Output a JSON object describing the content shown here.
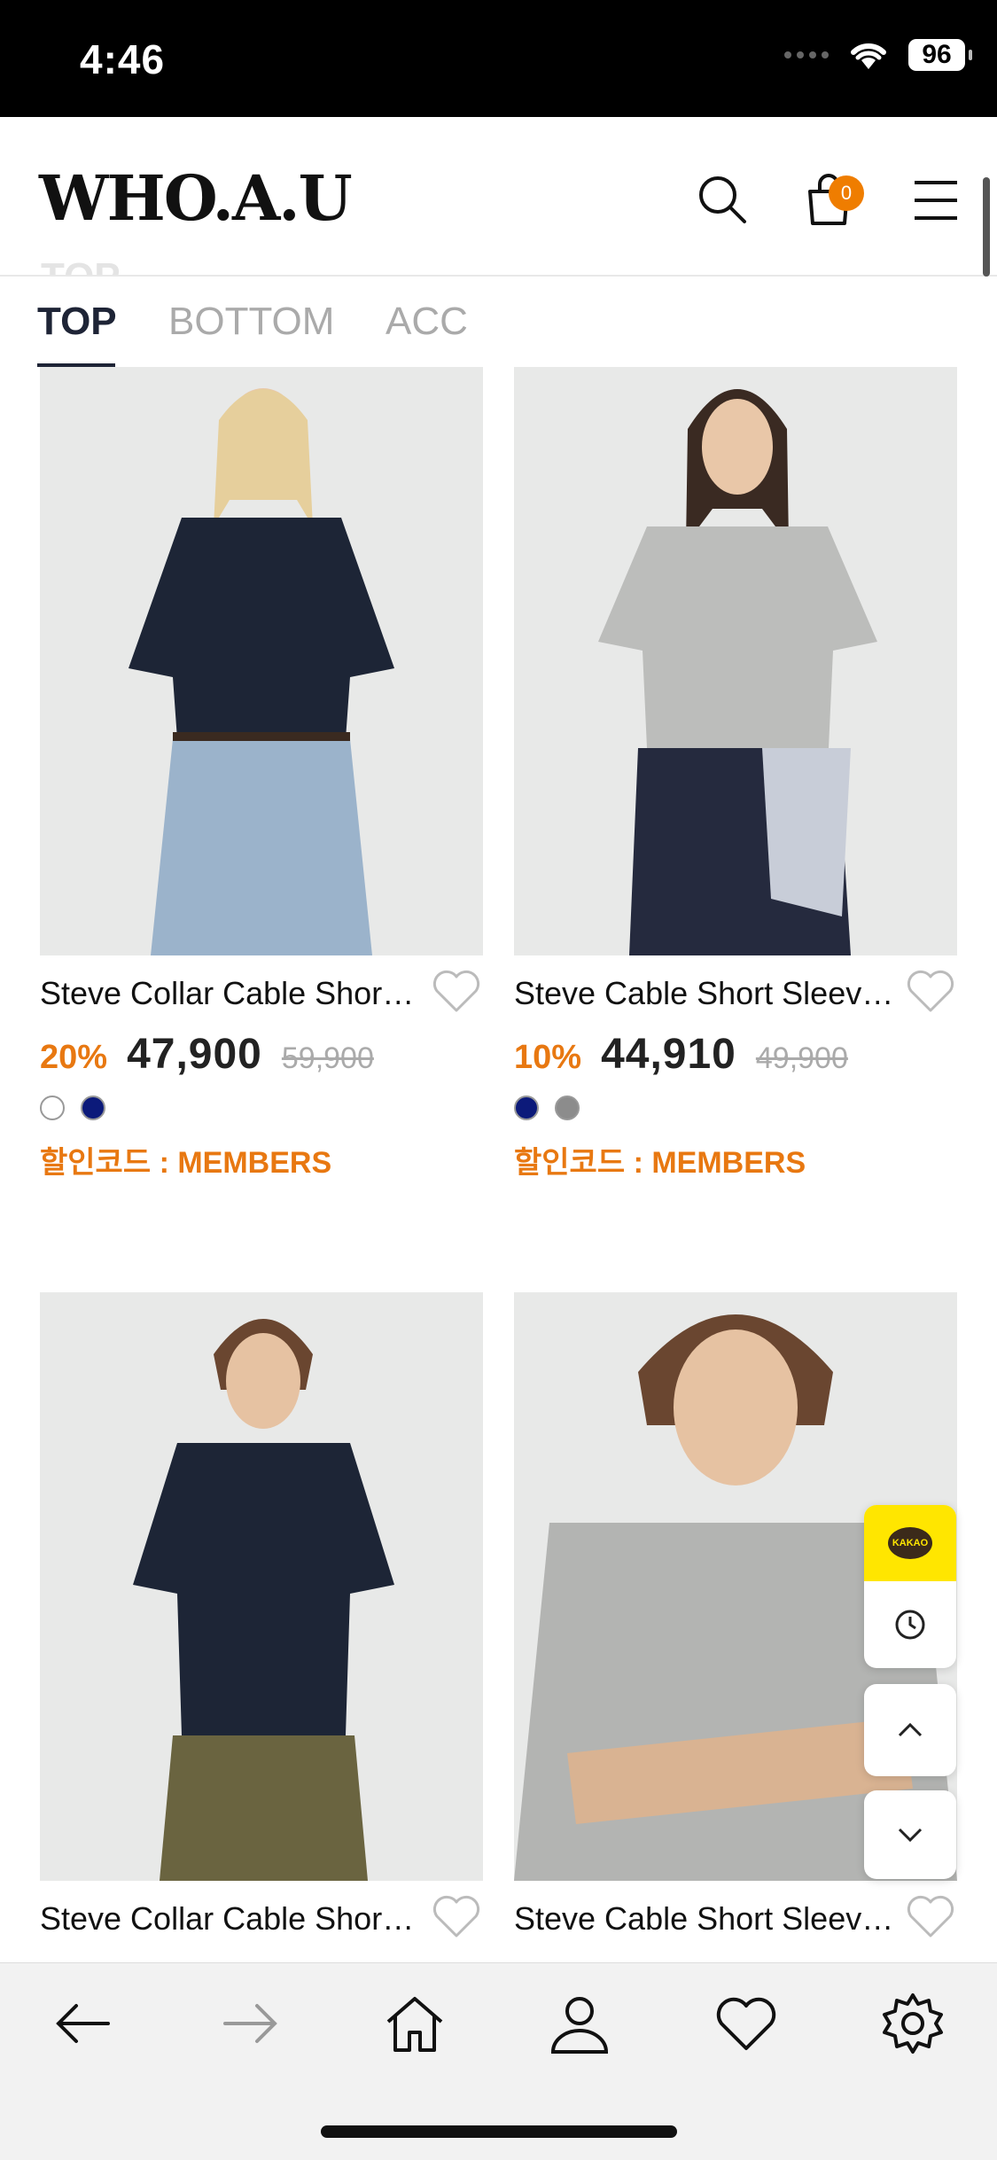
{
  "status_bar": {
    "time": "4:46",
    "battery": "96"
  },
  "header": {
    "logo": "WHO.A.U",
    "cart_count": "0"
  },
  "ghost_title": "TOP",
  "tabs": [
    {
      "label": "TOP",
      "active": true
    },
    {
      "label": "BOTTOM",
      "active": false
    },
    {
      "label": "ACC",
      "active": false
    }
  ],
  "products": [
    {
      "name": "Steve Collar Cable Short Sleeve Knit",
      "discount": "20%",
      "price": "47,900",
      "original_price": "59,900",
      "colors": [
        "#ffffff",
        "#0c1a7a"
      ],
      "promo": "할인코드 : MEMBERS"
    },
    {
      "name": "Steve Cable Short Sleeve Knit",
      "discount": "10%",
      "price": "44,910",
      "original_price": "49,900",
      "colors": [
        "#0c1a7a",
        "#8c8c8c"
      ],
      "promo": "할인코드 : MEMBERS"
    },
    {
      "name": "Steve Collar Cable Short Sleeve Knit"
    },
    {
      "name": "Steve Cable Short Sleeve Knit"
    }
  ],
  "floating": {
    "kakao_label": "KAKAO"
  },
  "nav_icons": [
    "back-arrow-icon",
    "forward-arrow-icon",
    "home-icon",
    "user-icon",
    "heart-icon",
    "settings-gear-icon"
  ]
}
